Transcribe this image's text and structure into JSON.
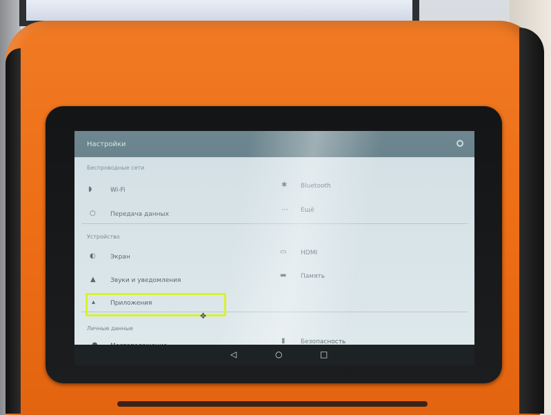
{
  "settings": {
    "title": "Настройки",
    "sections": [
      {
        "label": "Беспроводные сети"
      },
      {
        "label": "Устройство"
      },
      {
        "label": "Личные данные"
      }
    ],
    "items": {
      "wifi": "Wi-Fi",
      "bluetooth": "Bluetooth",
      "data_transfer": "Передача данных",
      "more": "Ещё",
      "screen": "Экран",
      "hdmi": "HDMI",
      "sound": "Звуки и уведомления",
      "memory": "Память",
      "apps": "Приложения",
      "location": "Местоположение",
      "security": "Безопасность"
    }
  },
  "icons": {
    "search": "search-icon",
    "wifi": "wifi-icon",
    "bluetooth": "bluetooth-icon",
    "data": "data-usage-icon",
    "more": "more-icon",
    "screen": "display-icon",
    "hdmi": "monitor-icon",
    "sound": "bell-icon",
    "memory": "storage-icon",
    "apps": "android-icon",
    "location": "location-icon",
    "security": "lock-icon",
    "nav_back": "back-icon",
    "nav_home": "home-icon",
    "nav_recents": "recents-icon"
  },
  "colors": {
    "device": "#EE6F16",
    "appbar": "#4F6A73",
    "highlight": "#D8F22A"
  }
}
